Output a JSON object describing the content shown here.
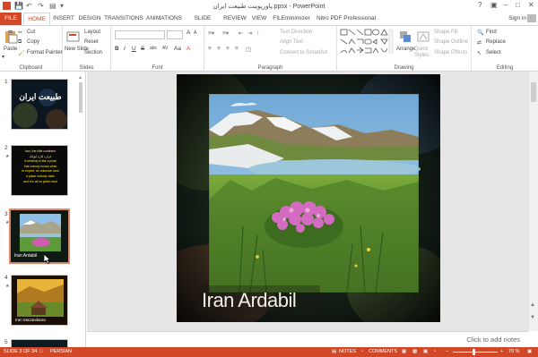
{
  "window": {
    "title": "پاورپوینت طبیعت ایران.ppsx - PowerPoint",
    "help": "?",
    "sign_in": "Sign in"
  },
  "tabs": [
    "FILE",
    "HOME",
    "INSERT",
    "DESIGN",
    "TRANSITIONS",
    "ANIMATIONS",
    "SLIDE SHOW",
    "REVIEW",
    "VIEW",
    "FILEminimizer",
    "Nitro PDF Professional"
  ],
  "ribbon": {
    "clipboard": {
      "label": "Clipboard",
      "paste": "Paste",
      "cut": "Cut",
      "copy": "Copy",
      "format_painter": "Format Painter"
    },
    "slides": {
      "label": "Slides",
      "new_slide": "New Slide",
      "layout": "Layout",
      "reset": "Reset",
      "section": "Section"
    },
    "font": {
      "label": "Font",
      "bold": "B",
      "italic": "I",
      "underline": "U",
      "strike": "S",
      "shadow": "abc",
      "spacing": "AV",
      "case": "Aa",
      "grow": "A",
      "shrink": "A",
      "clear": "A"
    },
    "paragraph": {
      "label": "Paragraph",
      "text_direction": "Text Direction",
      "align_text": "Align Text",
      "convert_smartart": "Convert to SmartArt"
    },
    "drawing": {
      "label": "Drawing",
      "arrange": "Arrange",
      "quick_styles": "Quick Styles",
      "shape_fill": "Shape Fill",
      "shape_outline": "Shape Outline",
      "shape_effects": "Shape Effects"
    },
    "editing": {
      "label": "Editing",
      "find": "Find",
      "replace": "Replace",
      "select": "Select"
    }
  },
  "thumbnails": [
    {
      "num": "1",
      "title": "طبیعت ایران"
    },
    {
      "num": "2",
      "lines": [
        "Iran, the little continent",
        "ایران، قاره کوچک",
        "It certainly is like a jewel",
        "that nobody knows what",
        "to expect, an unknown land",
        "a place nobody visits",
        "and it is all so green land"
      ]
    },
    {
      "num": "3",
      "caption": "Iran Ardabil"
    },
    {
      "num": "4",
      "caption": "Iran Mazandaran"
    },
    {
      "num": "5"
    }
  ],
  "slide": {
    "caption": "Iran Ardabil"
  },
  "notes_placeholder": "Click to add notes",
  "status": {
    "slide_counter": "SLIDE 3 OF 34",
    "language": "PERSIAN",
    "notes": "NOTES",
    "comments": "COMMENTS",
    "zoom": "70 %"
  },
  "colors": {
    "accent": "#d24726"
  }
}
